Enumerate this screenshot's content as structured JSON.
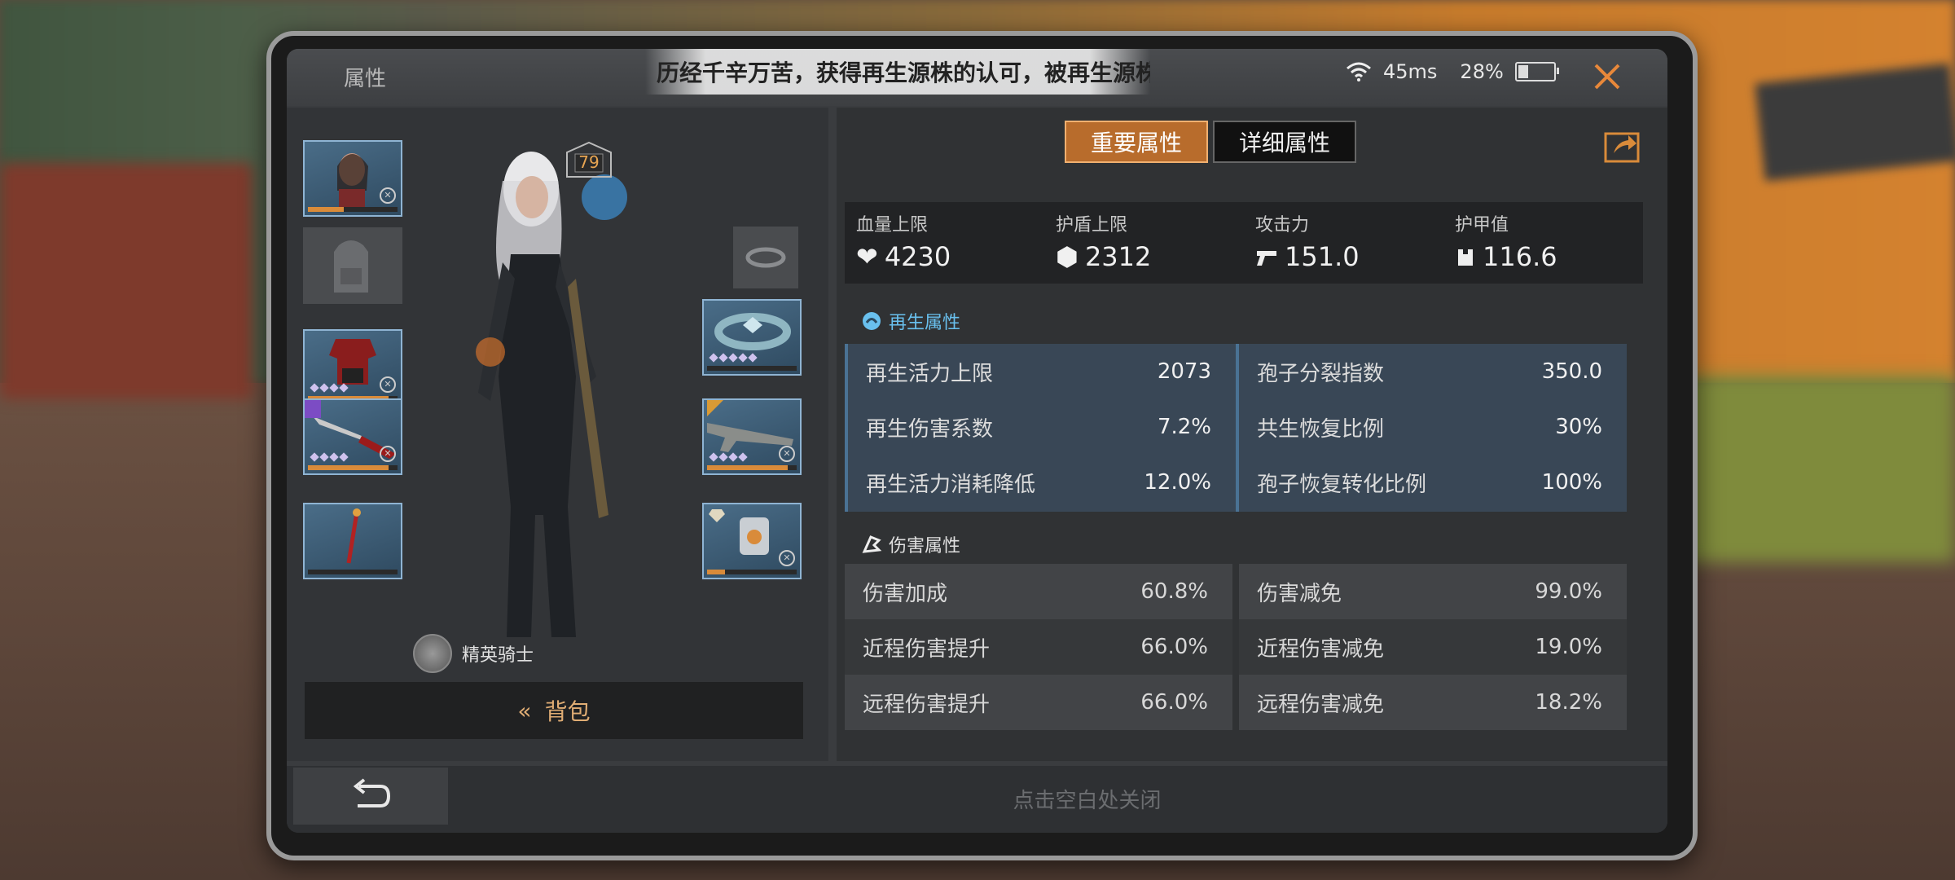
{
  "window": {
    "title": "属性",
    "banner": "历经千辛万苦，获得再生源株的认可，被再生源株认证为枪械",
    "network_latency": "45ms",
    "battery": "28%"
  },
  "character": {
    "level": "79",
    "rank": "精英骑士",
    "bag_label": "背包",
    "equipment_slots": [
      {
        "name": "portrait",
        "durability": 0.4
      },
      {
        "name": "backpack-empty"
      },
      {
        "name": "armor",
        "durability": 0.9
      },
      {
        "name": "blade-weapon",
        "durability": 0.9
      },
      {
        "name": "staff",
        "durability": 0.0
      },
      {
        "name": "ring-empty"
      },
      {
        "name": "bracelet",
        "durability": 0.0
      },
      {
        "name": "rifle",
        "durability": 0.9
      },
      {
        "name": "mech-shield",
        "durability": 0.2
      }
    ]
  },
  "tabs": {
    "important": "重要属性",
    "detail": "详细属性"
  },
  "main_stats": [
    {
      "label": "血量上限",
      "value": "4230",
      "icon": "heart-icon"
    },
    {
      "label": "护盾上限",
      "value": "2312",
      "icon": "shield-icon"
    },
    {
      "label": "攻击力",
      "value": "151.0",
      "icon": "gun-icon"
    },
    {
      "label": "护甲值",
      "value": "116.6",
      "icon": "armor-icon"
    }
  ],
  "regen_section": {
    "title": "再生属性",
    "left": [
      {
        "k": "再生活力上限",
        "v": "2073"
      },
      {
        "k": "再生伤害系数",
        "v": "7.2%"
      },
      {
        "k": "再生活力消耗降低",
        "v": "12.0%"
      }
    ],
    "right": [
      {
        "k": "孢子分裂指数",
        "v": "350.0"
      },
      {
        "k": "共生恢复比例",
        "v": "30%"
      },
      {
        "k": "孢子恢复转化比例",
        "v": "100%"
      }
    ]
  },
  "damage_section": {
    "title": "伤害属性",
    "left": [
      {
        "k": "伤害加成",
        "v": "60.8%"
      },
      {
        "k": "近程伤害提升",
        "v": "66.0%"
      },
      {
        "k": "远程伤害提升",
        "v": "66.0%"
      }
    ],
    "right": [
      {
        "k": "伤害减免",
        "v": "99.0%"
      },
      {
        "k": "近程伤害减免",
        "v": "19.0%"
      },
      {
        "k": "远程伤害减免",
        "v": "18.2%"
      }
    ]
  },
  "footer": {
    "hint": "点击空白处关闭"
  },
  "colors": {
    "accent_orange": "#e8883a",
    "regen_blue": "#69c0ee"
  }
}
